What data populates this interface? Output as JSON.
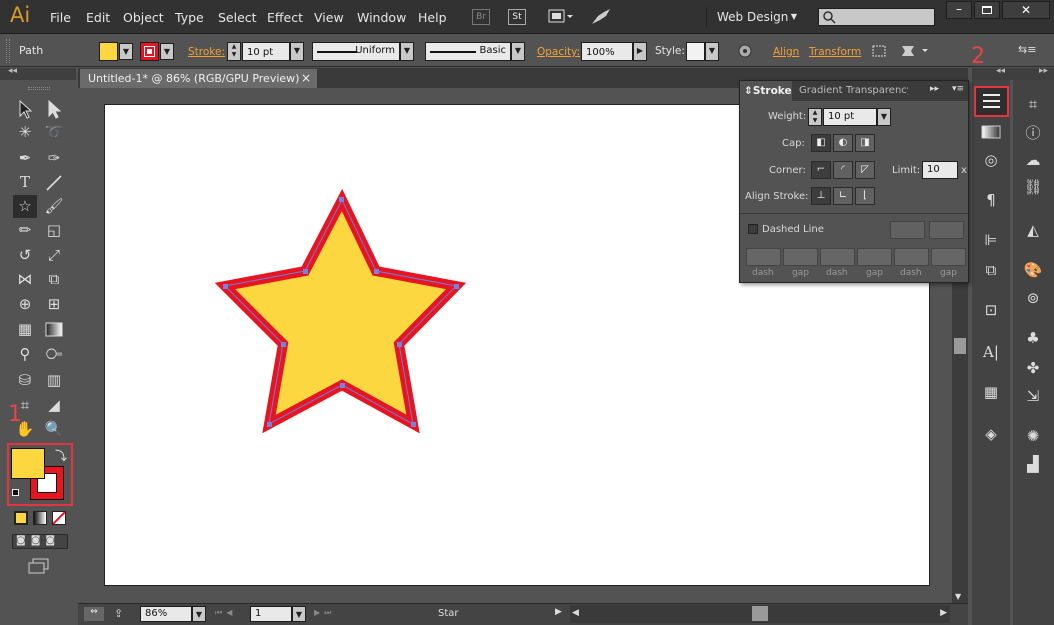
{
  "app": {
    "logo": "Ai",
    "workspace": "Web Design"
  },
  "menu": [
    "File",
    "Edit",
    "Object",
    "Type",
    "Select",
    "Effect",
    "View",
    "Window",
    "Help"
  ],
  "menubar_buttons": {
    "bridge": "Br",
    "stock": "St"
  },
  "control": {
    "selection": "Path",
    "stroke_label": "Stroke:",
    "stroke_weight": "10 pt",
    "profile": "Uniform",
    "brush": "Basic",
    "opacity_label": "Opacity:",
    "opacity": "100%",
    "style_label": "Style:",
    "align_label": "Align",
    "transform_label": "Transform"
  },
  "document": {
    "tab_title": "Untitled-1* @ 86% (RGB/GPU Preview)",
    "close": "×"
  },
  "stroke_panel": {
    "tabs": [
      "Stroke",
      "Gradient",
      "Transparency"
    ],
    "weight_label": "Weight:",
    "weight": "10 pt",
    "cap_label": "Cap:",
    "corner_label": "Corner:",
    "limit_label": "Limit:",
    "limit": "10",
    "limit_unit": "x",
    "align_label": "Align Stroke:",
    "dashed_label": "Dashed Line",
    "dash_labels": [
      "dash",
      "gap",
      "dash",
      "gap",
      "dash",
      "gap"
    ]
  },
  "status": {
    "zoom": "86%",
    "page": "1",
    "tool": "Star"
  },
  "annotations": {
    "fill_stroke": "1",
    "stroke_panel": "2"
  },
  "colors": {
    "fill": "#fdd73f",
    "stroke": "#e8141f",
    "accent": "#f0a133",
    "highlight": "#e2353d"
  }
}
